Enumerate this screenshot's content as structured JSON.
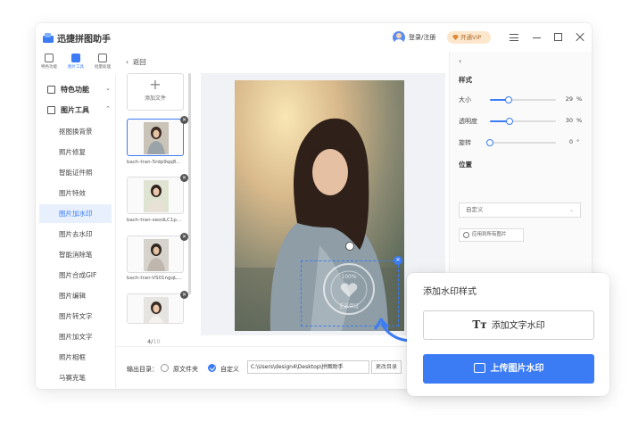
{
  "app": {
    "title": "迅捷拼图助手",
    "login": "登录/注册",
    "vip": "开通VIP"
  },
  "category_tabs": [
    {
      "label": "特色功能"
    },
    {
      "label": "图片工具"
    },
    {
      "label": "批量处理"
    }
  ],
  "sidebar": {
    "group_features": "特色功能",
    "group_tools": "图片工具",
    "items": [
      "抠图换背景",
      "照片修复",
      "智能证件照",
      "图片特效",
      "图片加水印",
      "图片去水印",
      "智能消除笔",
      "图片合成GIF",
      "图片编辑",
      "图片转文字",
      "图片加文字",
      "照片相框",
      "马赛克笔"
    ],
    "active_item": "图片加水印"
  },
  "files": {
    "back": "返回",
    "add_label": "添加文件",
    "thumbs": [
      {
        "name": "bach-tran-5rdp9qq8..."
      },
      {
        "name": "bach-tran-xeodLC1p..."
      },
      {
        "name": "bach-tran-VS01ngqL..."
      },
      {
        "name": ""
      }
    ],
    "page_current": "4/",
    "page_total": "10"
  },
  "output": {
    "label": "输出目录：",
    "opt_source": "原文件夹",
    "opt_custom": "自定义",
    "path": "C:\\Users\\design4\\Desktop\\拼图助手",
    "change": "更改目录"
  },
  "right_panel": {
    "style_title": "样式",
    "size_label": "大小",
    "size_value": "29",
    "size_unit": "%",
    "size_fraction": 0.29,
    "opacity_label": "透明度",
    "opacity_value": "30",
    "opacity_unit": "%",
    "opacity_fraction": 0.3,
    "rotate_label": "旋转",
    "rotate_value": "0",
    "rotate_unit": "°",
    "rotate_fraction": 0,
    "position_title": "位置",
    "position_value": "自定义",
    "apply_all": "应用到所有图片"
  },
  "popup": {
    "title": "添加水印样式",
    "text_button": "添加文字水印",
    "image_button": "上传图片水印"
  },
  "watermark": {
    "top_text": "100%",
    "bottom_text": "正品保证"
  },
  "colors": {
    "accent": "#3b7cf5",
    "vip_bg": "#fde7cc",
    "vip_text": "#a8672a"
  }
}
